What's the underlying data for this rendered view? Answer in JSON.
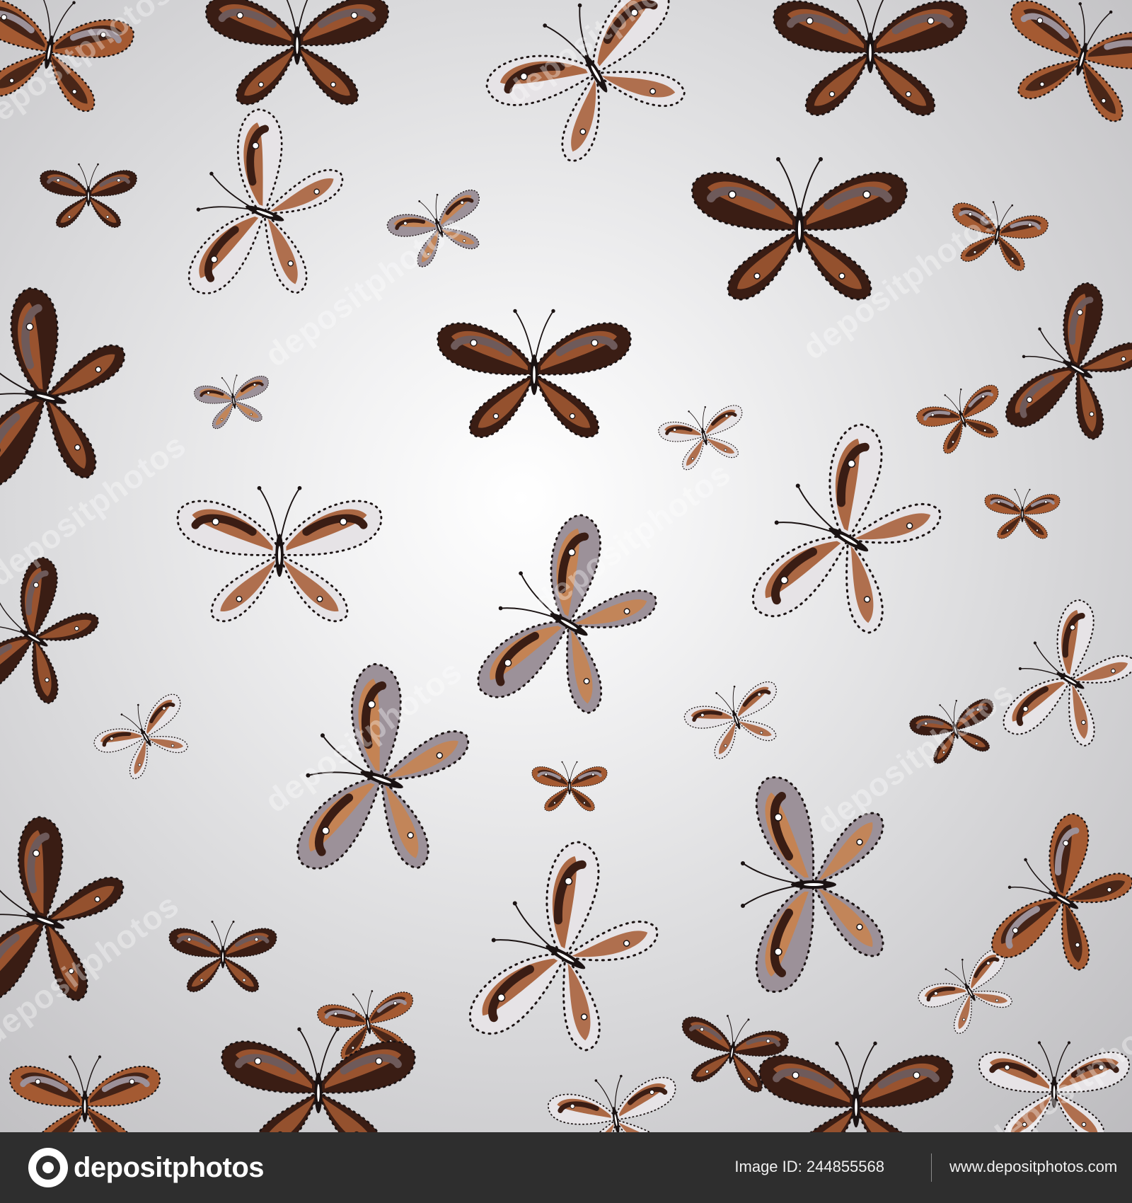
{
  "artwork": {
    "background_center": "#ffffff",
    "background_edge": "#bdbcbf",
    "palette": [
      "#3a1d14",
      "#a45a32",
      "#c9824d",
      "#6e5a5a",
      "#9c9199",
      "#e6e3e6"
    ],
    "watermark_text": "depositphotos",
    "watermarks": [
      {
        "text": "depositphotos"
      },
      {
        "text": "depositphotos"
      },
      {
        "text": "depositphotos"
      },
      {
        "text": "depositphotos"
      },
      {
        "text": "depositphotos"
      },
      {
        "text": "depositphotos"
      },
      {
        "text": "depositphotos"
      },
      {
        "text": "depositphotos"
      },
      {
        "text": "depositphotos"
      },
      {
        "text": "depositphotos"
      }
    ],
    "motif": "butterfly-icon"
  },
  "footer": {
    "logo_text": "depositphotos",
    "logo_icon": "depositphotos-logo-icon",
    "image_id": "Image ID: 244855568",
    "url": "www.depositphotos.com"
  }
}
